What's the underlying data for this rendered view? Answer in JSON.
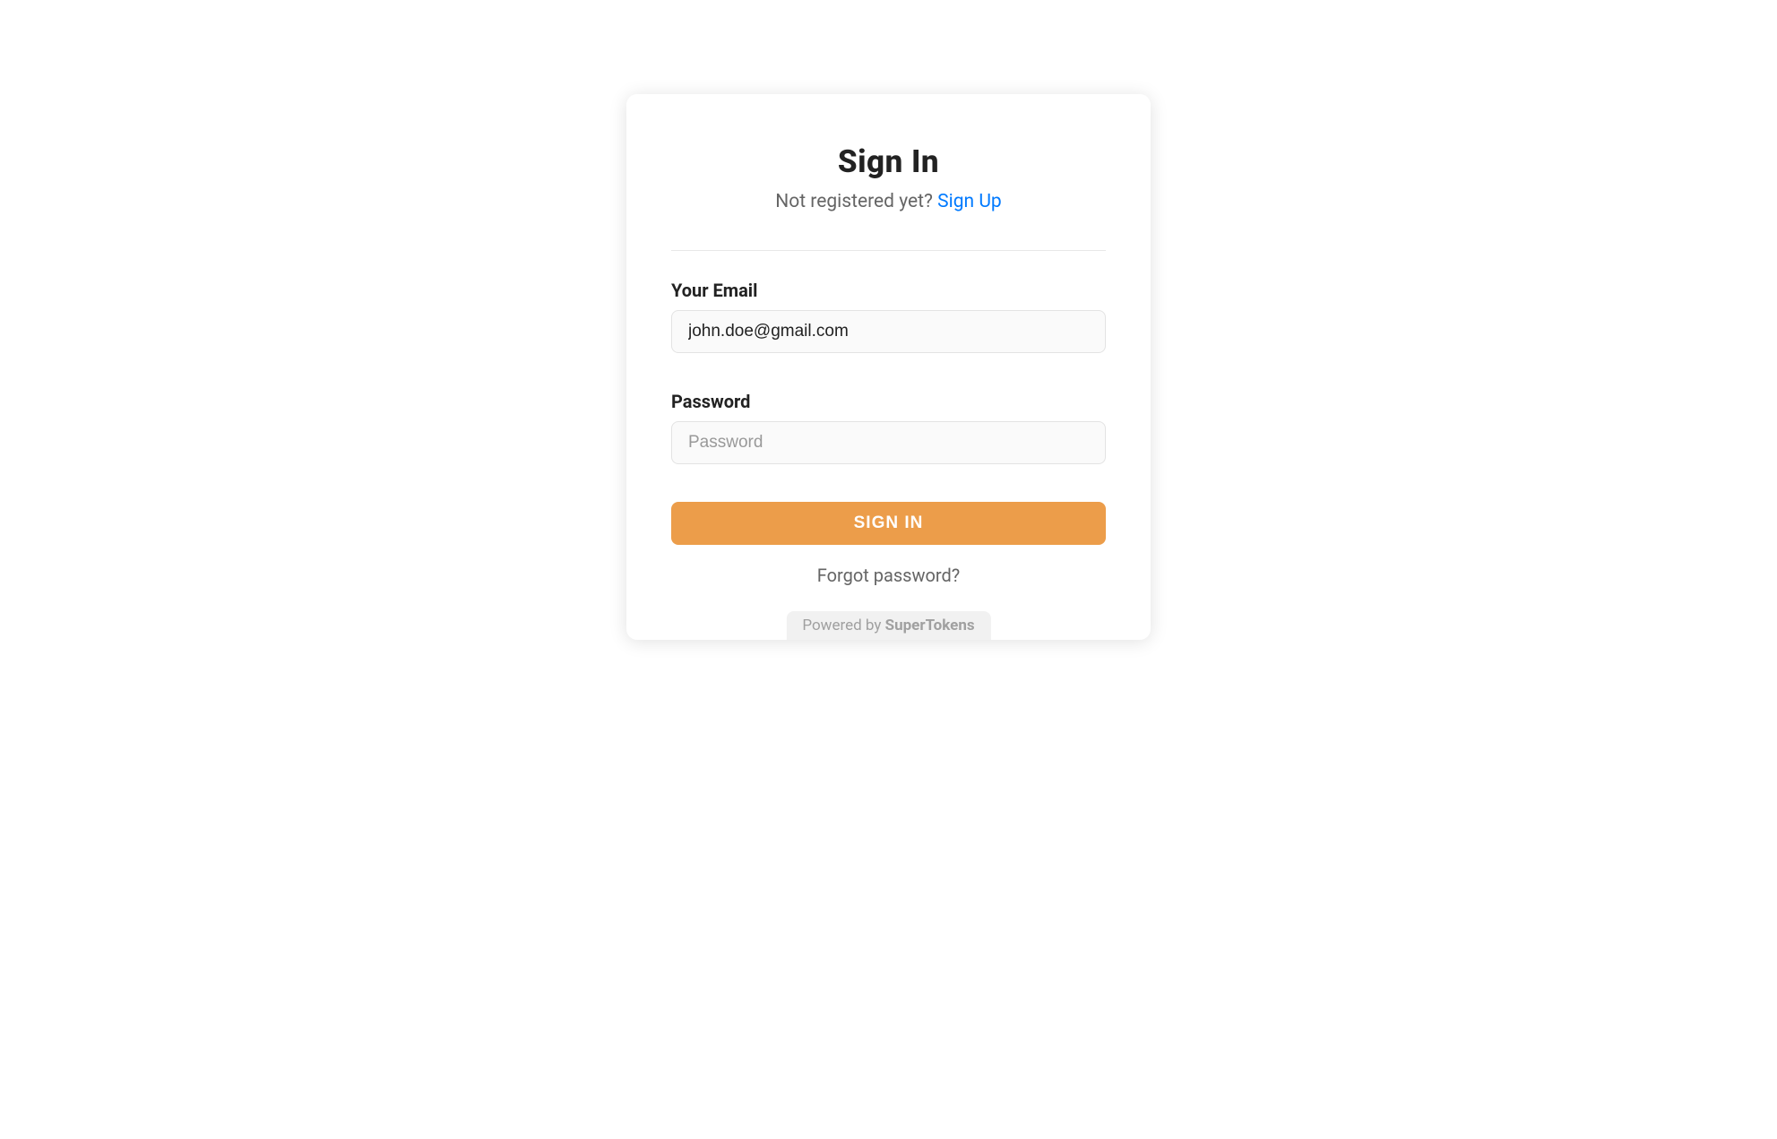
{
  "header": {
    "title": "Sign In",
    "subtitle_text": "Not registered yet? ",
    "subtitle_link": "Sign Up"
  },
  "form": {
    "email": {
      "label": "Your Email",
      "value": "john.doe@gmail.com",
      "placeholder": ""
    },
    "password": {
      "label": "Password",
      "value": "",
      "placeholder": "Password"
    },
    "submit_label": "SIGN IN",
    "forgot_label": "Forgot password?"
  },
  "footer": {
    "powered_by_text": "Powered by ",
    "powered_by_brand": "SuperTokens"
  }
}
